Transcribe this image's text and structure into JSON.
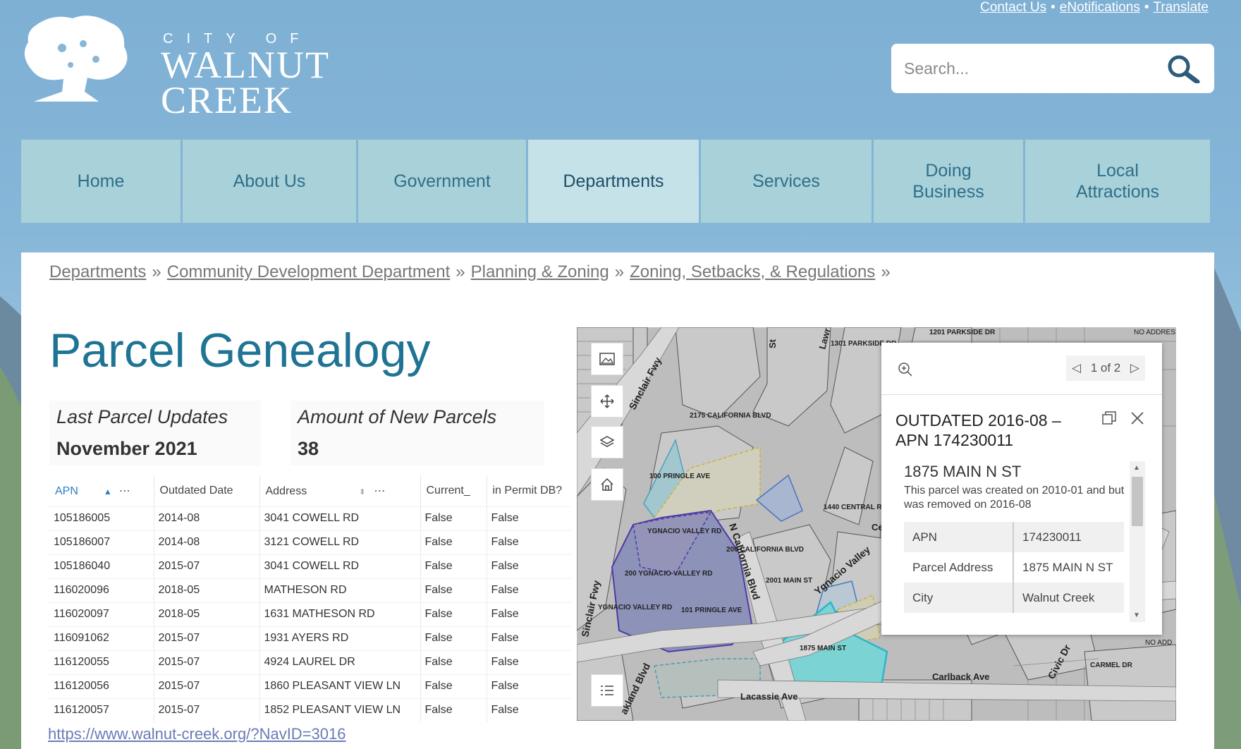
{
  "header": {
    "logo_small": "CITY OF",
    "logo_line1": "WALNUT",
    "logo_line2": "CREEK",
    "top_links": [
      "Contact Us",
      "eNotifications",
      "Translate"
    ],
    "search_placeholder": "Search..."
  },
  "nav": {
    "items": [
      "Home",
      "About Us",
      "Government",
      "Departments",
      "Services",
      "Doing Business",
      "Local Attractions"
    ],
    "active": "Departments"
  },
  "breadcrumb": [
    "Departments",
    "Community Development Department",
    "Planning & Zoning",
    "Zoning, Setbacks, & Regulations"
  ],
  "page": {
    "title": "Parcel Genealogy",
    "stat1_label": "Last Parcel Updates",
    "stat1_value": "November 2021",
    "stat2_label": "Amount of New Parcels",
    "stat2_value": "38",
    "url": "https://www.walnut-creek.org/?NavID=3016"
  },
  "table": {
    "columns": [
      "APN",
      "Outdated Date",
      "Address",
      "Current_",
      "in Permit DB?"
    ],
    "rows": [
      [
        "105186005",
        "2014-08",
        "3041 COWELL RD",
        "False",
        "False"
      ],
      [
        "105186007",
        "2014-08",
        "3121 COWELL RD",
        "False",
        "False"
      ],
      [
        "105186040",
        "2015-07",
        "3041 COWELL RD",
        "False",
        "False"
      ],
      [
        "116020096",
        "2018-05",
        "MATHESON RD",
        "False",
        "False"
      ],
      [
        "116020097",
        "2018-05",
        "1631 MATHESON RD",
        "False",
        "False"
      ],
      [
        "116091062",
        "2015-07",
        "1931 AYERS RD",
        "False",
        "False"
      ],
      [
        "116120055",
        "2015-07",
        "4924 LAUREL DR",
        "False",
        "False"
      ],
      [
        "116120056",
        "2015-07",
        "1860 PLEASANT VIEW LN",
        "False",
        "False"
      ],
      [
        "116120057",
        "2015-07",
        "1852 PLEASANT VIEW LN",
        "False",
        "False"
      ]
    ]
  },
  "map": {
    "labels": {
      "parkside1": "1201 PARKSIDE DR",
      "parkside2": "1301 PARKSIDE DR",
      "no_address1": "NO ADDRESS",
      "no_address2": "NO ADD",
      "sinclair1": "Sinclair Fwy",
      "sinclair2": "Sinclair Fwy",
      "california2175": "2175 CALIFORNIA BLVD",
      "pringle100": "100 PRINGLE AVE",
      "central1440": "1440 CENTRAL R",
      "centr": "Cent",
      "ygnacio_valley_rd": "YGNACIO VALLEY RD",
      "california_blvd": "N California Blvd",
      "california200": "200 CALIFORNIA BLVD",
      "ygnacio_valley": "Ygnacio Valley",
      "ygnacio200": "200 YGNACIO VALLEY RD",
      "main2001": "2001 MAIN ST",
      "ygnacio_valley_rd2": "YGNACIO VALLEY RD",
      "pringle101": "101 PRINGLE AVE",
      "main1875": "1875 MAIN ST",
      "carmel": "CARMEL DR",
      "carlback": "Carlback Ave",
      "civic": "Civic Dr",
      "lacassie": "Lacassie Ave",
      "oakland": "akland Blvd",
      "st": "St",
      "law": "Lawr"
    },
    "popup": {
      "pager": "1 of 2",
      "title": "OUTDATED 2016-08 – APN 174230011",
      "address": "1875 MAIN N ST",
      "description": "This parcel was created on 2010-01 and but was removed on 2016-08",
      "fields": [
        {
          "label": "APN",
          "value": "174230011"
        },
        {
          "label": "Parcel Address",
          "value": "1875 MAIN N ST"
        },
        {
          "label": "City",
          "value": "Walnut Creek"
        }
      ]
    }
  }
}
